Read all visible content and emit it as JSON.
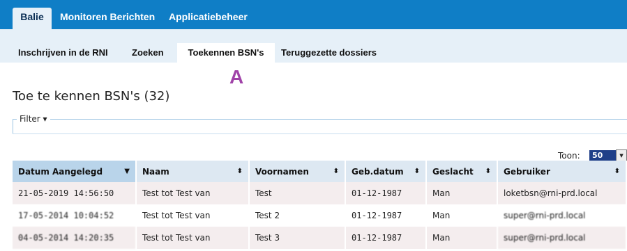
{
  "topnav": {
    "tabs": [
      {
        "label": "Balie",
        "active": true
      },
      {
        "label": "Monitoren Berichten",
        "active": false
      },
      {
        "label": "Applicatiebeheer",
        "active": false
      }
    ]
  },
  "subnav": {
    "tabs": [
      {
        "label": "Inschrijven in de RNI",
        "active": false
      },
      {
        "label": "Zoeken",
        "active": false
      },
      {
        "label": "Toekennen BSN's",
        "active": true
      },
      {
        "label": "Teruggezette dossiers",
        "active": false
      }
    ]
  },
  "annotation_marker": "A",
  "page_title": "Toe te kennen BSN's (32)",
  "filter": {
    "label": "Filter ▾"
  },
  "pagesize": {
    "label": "Toon:",
    "value": "50",
    "arrow": "▾"
  },
  "table": {
    "columns": [
      {
        "label": "Datum Aangelegd",
        "sort": "▼"
      },
      {
        "label": "Naam",
        "sort": "⬍"
      },
      {
        "label": "Voornamen",
        "sort": "⬍"
      },
      {
        "label": "Geb.datum",
        "sort": "⬍"
      },
      {
        "label": "Geslacht",
        "sort": "⬍"
      },
      {
        "label": "Gebruiker",
        "sort": "⬍"
      }
    ],
    "rows": [
      [
        "21-05-2019 14:56:50",
        "Test tot Test van",
        "Test",
        "01-12-1987",
        "Man",
        "loketbsn@rni-prd.local"
      ],
      [
        "17-05-2014 10:04:52",
        "Test tot Test van",
        "Test 2",
        "01-12-1987",
        "Man",
        "super@rni-prd.local"
      ],
      [
        "04-05-2014 14:20:35",
        "Test tot Test van",
        "Test 3",
        "01-12-1987",
        "Man",
        "super@rni-prd.local"
      ]
    ]
  },
  "colors": {
    "topbar": "#0f7ec6",
    "subbar": "#e6f0f8",
    "marker": "#a042a8",
    "header": "#dde8f2",
    "row_odd": "#f4edee"
  }
}
